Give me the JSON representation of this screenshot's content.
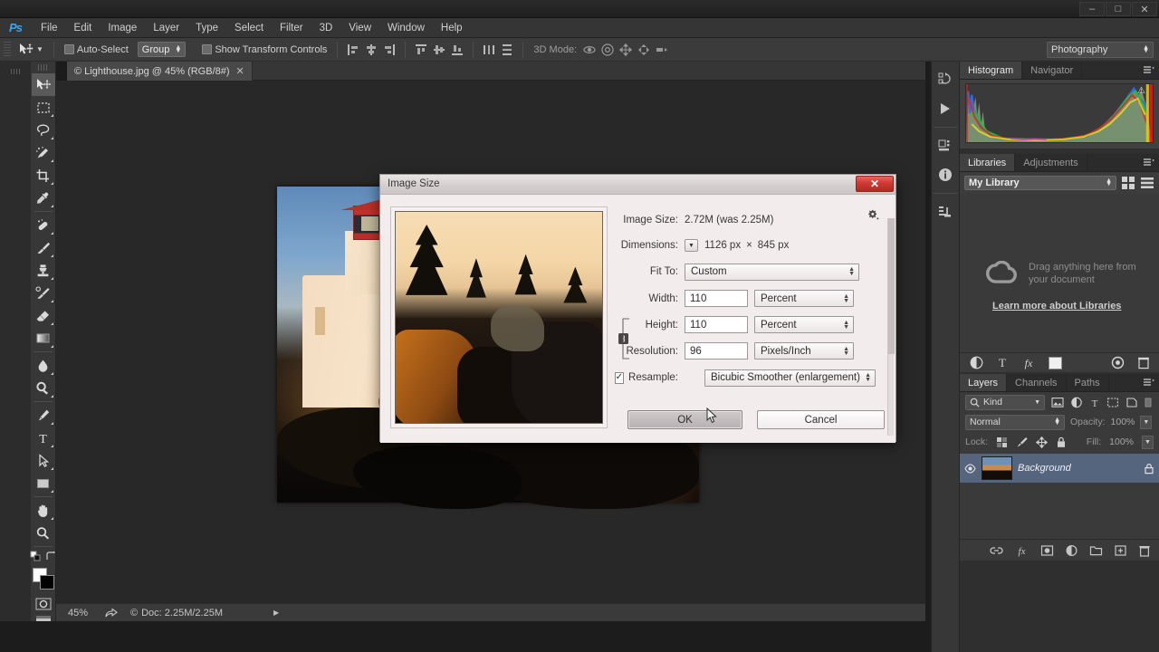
{
  "app": {
    "name": "Adobe Photoshop"
  },
  "titlebar": {
    "minimize": "–",
    "maximize": "□",
    "close": "✕"
  },
  "menubar": {
    "logo": "Ps",
    "items": [
      "File",
      "Edit",
      "Image",
      "Layer",
      "Type",
      "Select",
      "Filter",
      "3D",
      "View",
      "Window",
      "Help"
    ]
  },
  "options_bar": {
    "move_tool_icon": "move-tool-icon",
    "auto_select_label": "Auto-Select",
    "auto_select_checked": false,
    "group_value": "Group",
    "show_transform_label": "Show Transform Controls",
    "show_transform_checked": false,
    "mode_3d_label": "3D Mode:",
    "workspace": "Photography"
  },
  "tab": {
    "title": "© Lighthouse.jpg @ 45% (RGB/8#)",
    "close": "✕"
  },
  "toolbar": {
    "tools": [
      "move-tool",
      "rectangular-marquee-tool",
      "lasso-tool",
      "quick-selection-tool",
      "crop-tool",
      "eyedropper-tool",
      "spot-healing-brush-tool",
      "brush-tool",
      "clone-stamp-tool",
      "history-brush-tool",
      "eraser-tool",
      "gradient-tool",
      "blur-tool",
      "dodge-tool",
      "pen-tool",
      "horizontal-type-tool",
      "path-selection-tool",
      "rectangle-tool",
      "hand-tool",
      "zoom-tool"
    ],
    "foreground_color": "#ffffff",
    "background_color": "#000000",
    "quick_mask": "quick-mask-icon",
    "screen_mode": "screen-mode-icon"
  },
  "icon_dock": {
    "items": [
      "history-panel-icon",
      "actions-panel-icon",
      "properties-panel-icon",
      "info-panel-icon",
      "layer-comps-panel-icon"
    ]
  },
  "panels": {
    "histogram": {
      "tabs": [
        "Histogram",
        "Navigator"
      ],
      "active": "Histogram",
      "warning": "⚠"
    },
    "libraries": {
      "tabs": [
        "Libraries",
        "Adjustments"
      ],
      "active": "Libraries",
      "selected_library": "My Library",
      "empty_hint": "Drag anything here from your document",
      "link": "Learn more about Libraries"
    },
    "layers": {
      "tabs": [
        "Layers",
        "Channels",
        "Paths"
      ],
      "active": "Layers",
      "filter_kind": "Kind",
      "blend_mode": "Normal",
      "opacity_label": "Opacity:",
      "opacity_value": "100%",
      "lock_label": "Lock:",
      "fill_label": "Fill:",
      "fill_value": "100%",
      "rows": [
        {
          "name": "Background",
          "visible": true,
          "locked": true,
          "selected": true
        }
      ]
    }
  },
  "statusbar": {
    "zoom": "45%",
    "doc_info": "Doc: 2.25M/2.25M",
    "copyright": "©",
    "arrow": "▶"
  },
  "dialog": {
    "title": "Image Size",
    "close": "✕",
    "image_size_label": "Image Size:",
    "image_size_value": "2.72M (was 2.25M)",
    "gear_icon": "gear-icon",
    "dimensions_label": "Dimensions:",
    "dimensions_width": "1126 px",
    "dimensions_times": "×",
    "dimensions_height": "845 px",
    "fit_to_label": "Fit To:",
    "fit_to_value": "Custom",
    "width_label": "Width:",
    "width_value": "110",
    "width_unit": "Percent",
    "height_label": "Height:",
    "height_value": "110",
    "height_unit": "Percent",
    "resolution_label": "Resolution:",
    "resolution_value": "96",
    "resolution_unit": "Pixels/Inch",
    "resample_label": "Resample:",
    "resample_checked": true,
    "resample_value": "Bicubic Smoother (enlargement)",
    "ok_label": "OK",
    "cancel_label": "Cancel",
    "chain_icon": "link-constrain-icon"
  }
}
